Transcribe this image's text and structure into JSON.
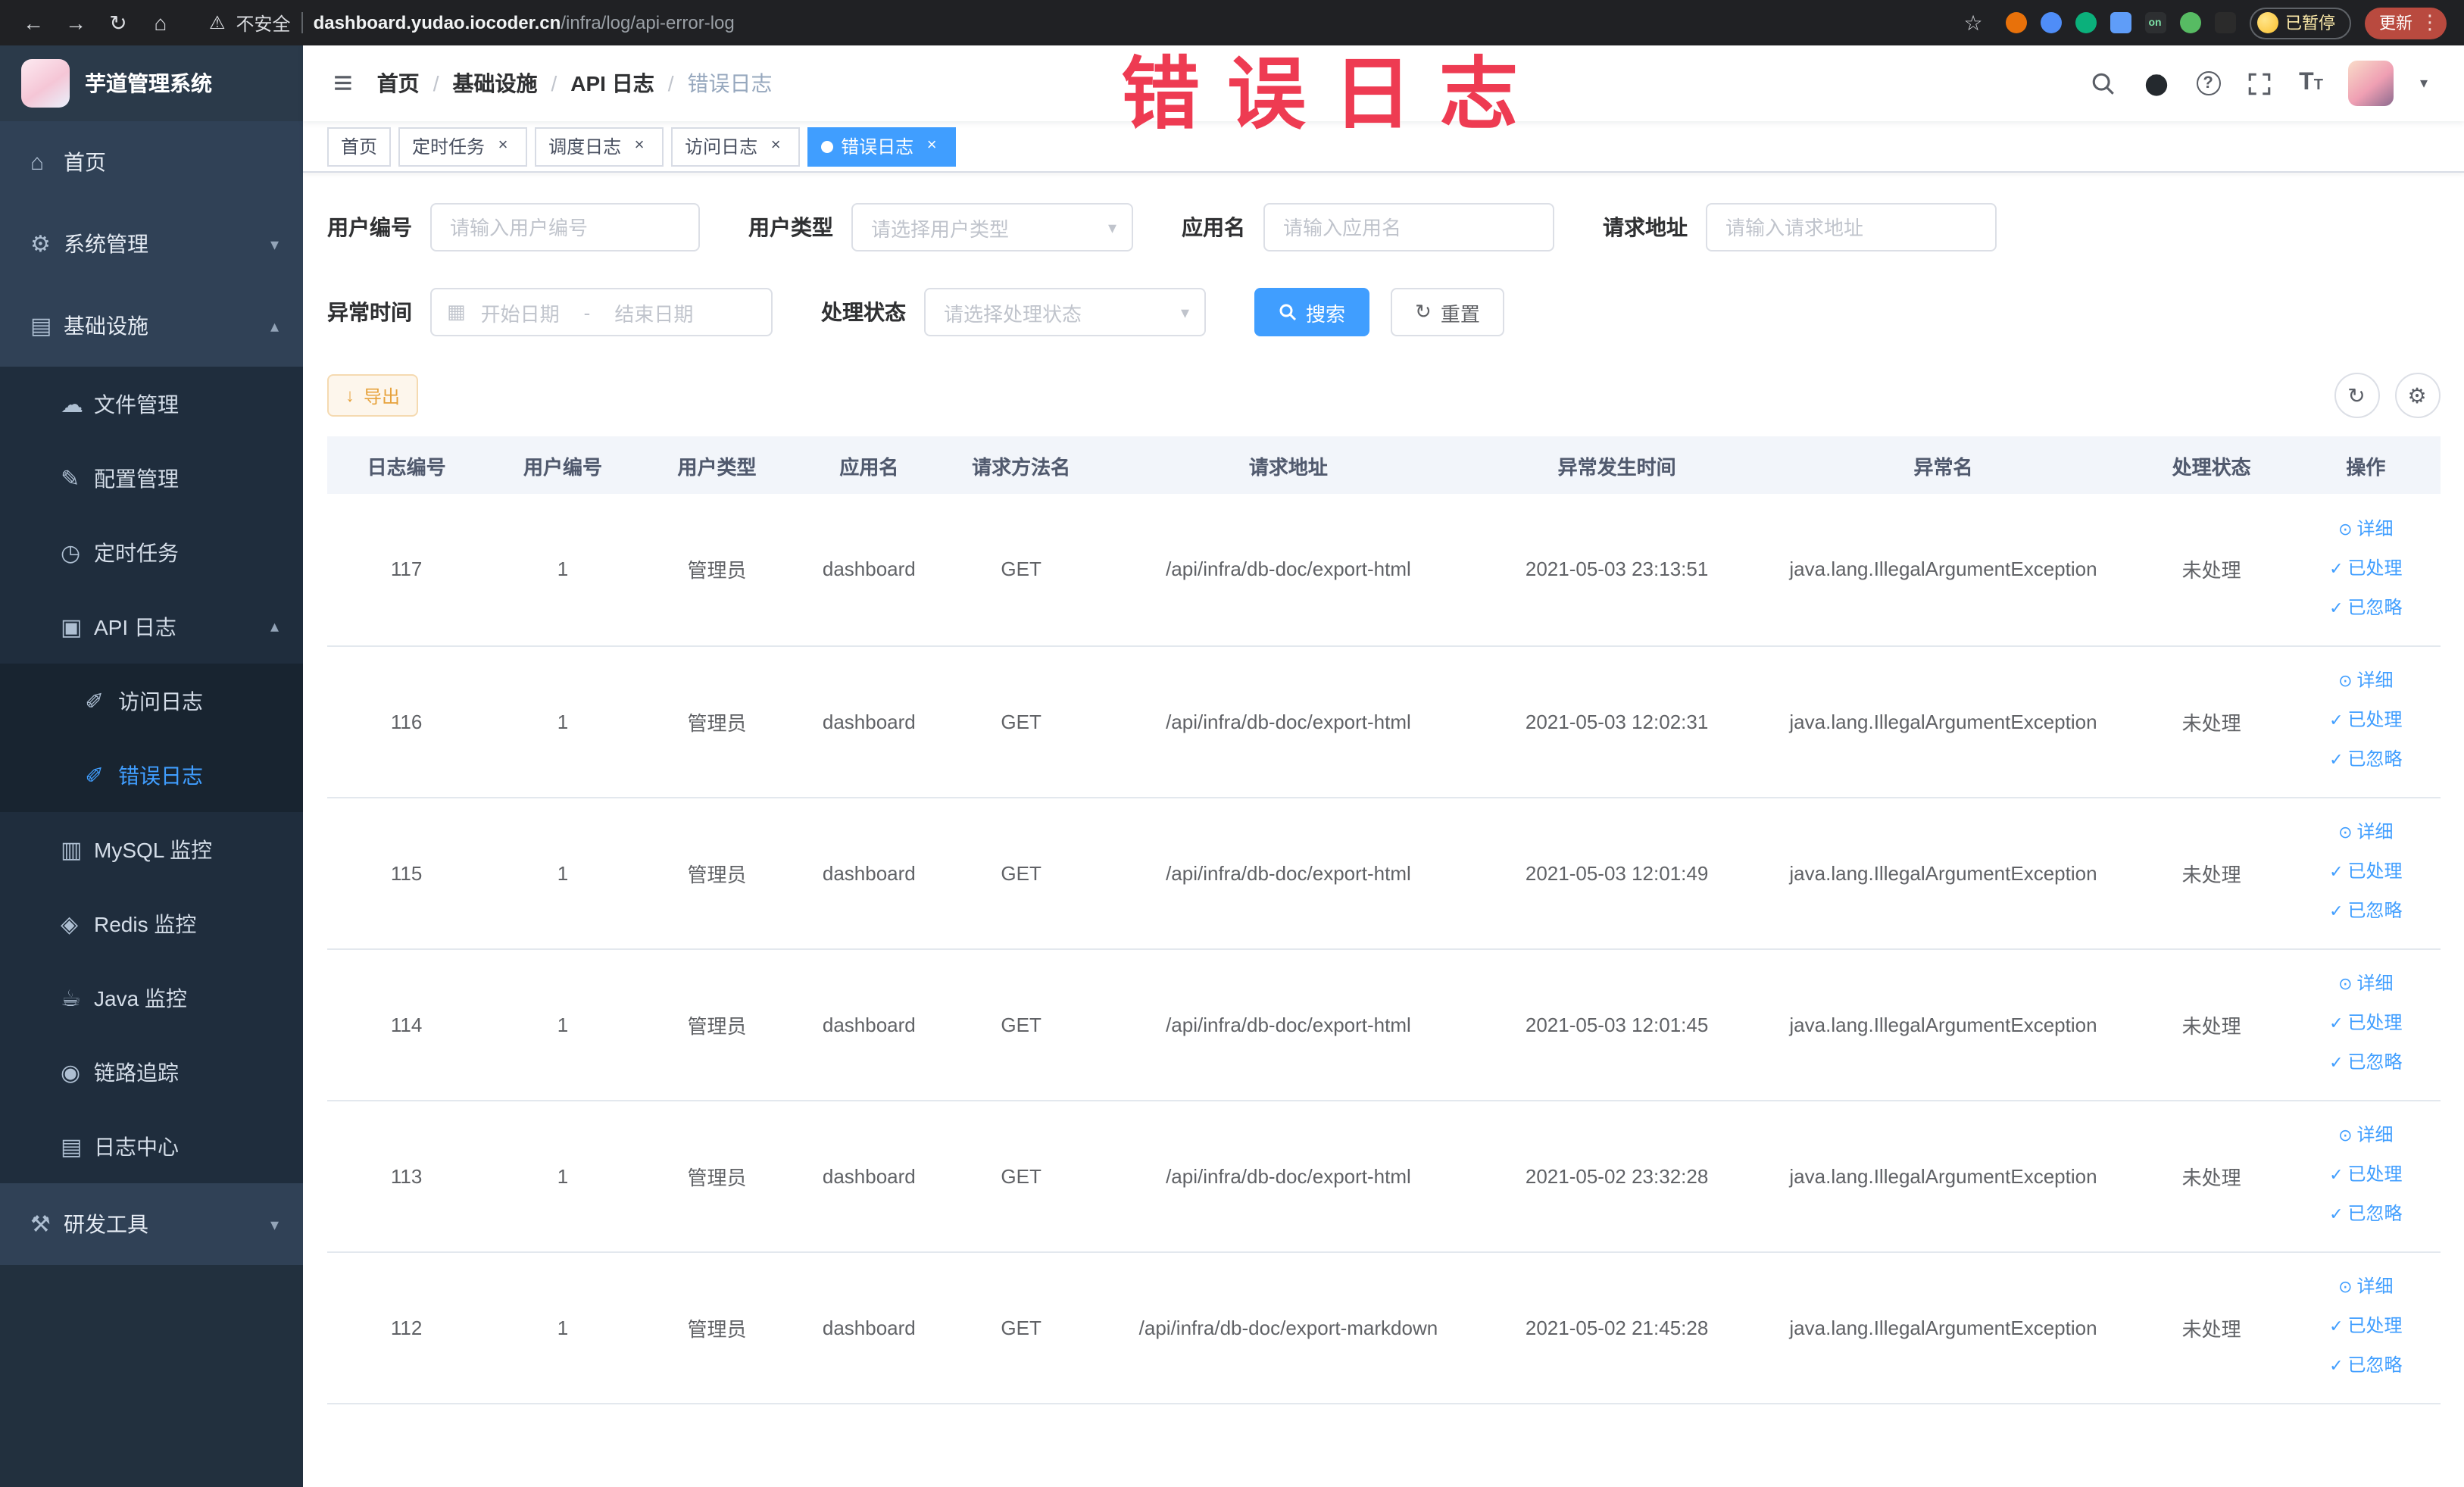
{
  "browser": {
    "security_label": "不安全",
    "url_host": "dashboard.yudao.iocoder.cn",
    "url_path": "/infra/log/api-error-log",
    "paused_badge": "已暂停",
    "update_button": "更新"
  },
  "annotation": "错误日志",
  "sidebar": {
    "app_title": "芋道管理系统",
    "menu": {
      "home": "首页",
      "system": "系统管理",
      "infra": "基础设施",
      "file": "文件管理",
      "config": "配置管理",
      "job": "定时任务",
      "api_log": "API 日志",
      "access_log": "访问日志",
      "error_log": "错误日志",
      "mysql": "MySQL 监控",
      "redis": "Redis 监控",
      "java": "Java 监控",
      "trace": "链路追踪",
      "log_center": "日志中心",
      "dev_tools": "研发工具"
    }
  },
  "breadcrumb": [
    "首页",
    "基础设施",
    "API 日志",
    "错误日志"
  ],
  "tabs": [
    {
      "label": "首页"
    },
    {
      "label": "定时任务"
    },
    {
      "label": "调度日志"
    },
    {
      "label": "访问日志"
    },
    {
      "label": "错误日志"
    }
  ],
  "filters": {
    "user_id_label": "用户编号",
    "user_id_placeholder": "请输入用户编号",
    "user_type_label": "用户类型",
    "user_type_placeholder": "请选择用户类型",
    "app_name_label": "应用名",
    "app_name_placeholder": "请输入应用名",
    "request_url_label": "请求地址",
    "request_url_placeholder": "请输入请求地址",
    "exception_time_label": "异常时间",
    "start_date_placeholder": "开始日期",
    "range_separator": "-",
    "end_date_placeholder": "结束日期",
    "process_status_label": "处理状态",
    "process_status_placeholder": "请选择处理状态",
    "search_button": "搜索",
    "reset_button": "重置"
  },
  "toolbar": {
    "export_button": "导出"
  },
  "table": {
    "headers": [
      "日志编号",
      "用户编号",
      "用户类型",
      "应用名",
      "请求方法名",
      "请求地址",
      "异常发生时间",
      "异常名",
      "处理状态",
      "操作"
    ],
    "row_actions": {
      "detail": "详细",
      "resolve": "已处理",
      "ignore": "已忽略"
    },
    "rows": [
      {
        "id": "117",
        "user_id": "1",
        "user_type": "管理员",
        "app": "dashboard",
        "method": "GET",
        "url": "/api/infra/db-doc/export-html",
        "time": "2021-05-03 23:13:51",
        "exception": "java.lang.IllegalArgumentException",
        "status": "未处理"
      },
      {
        "id": "116",
        "user_id": "1",
        "user_type": "管理员",
        "app": "dashboard",
        "method": "GET",
        "url": "/api/infra/db-doc/export-html",
        "time": "2021-05-03 12:02:31",
        "exception": "java.lang.IllegalArgumentException",
        "status": "未处理"
      },
      {
        "id": "115",
        "user_id": "1",
        "user_type": "管理员",
        "app": "dashboard",
        "method": "GET",
        "url": "/api/infra/db-doc/export-html",
        "time": "2021-05-03 12:01:49",
        "exception": "java.lang.IllegalArgumentException",
        "status": "未处理"
      },
      {
        "id": "114",
        "user_id": "1",
        "user_type": "管理员",
        "app": "dashboard",
        "method": "GET",
        "url": "/api/infra/db-doc/export-html",
        "time": "2021-05-03 12:01:45",
        "exception": "java.lang.IllegalArgumentException",
        "status": "未处理"
      },
      {
        "id": "113",
        "user_id": "1",
        "user_type": "管理员",
        "app": "dashboard",
        "method": "GET",
        "url": "/api/infra/db-doc/export-html",
        "time": "2021-05-02 23:32:28",
        "exception": "java.lang.IllegalArgumentException",
        "status": "未处理"
      },
      {
        "id": "112",
        "user_id": "1",
        "user_type": "管理员",
        "app": "dashboard",
        "method": "GET",
        "url": "/api/infra/db-doc/export-markdown",
        "time": "2021-05-02 21:45:28",
        "exception": "java.lang.IllegalArgumentException",
        "status": "未处理"
      }
    ]
  }
}
